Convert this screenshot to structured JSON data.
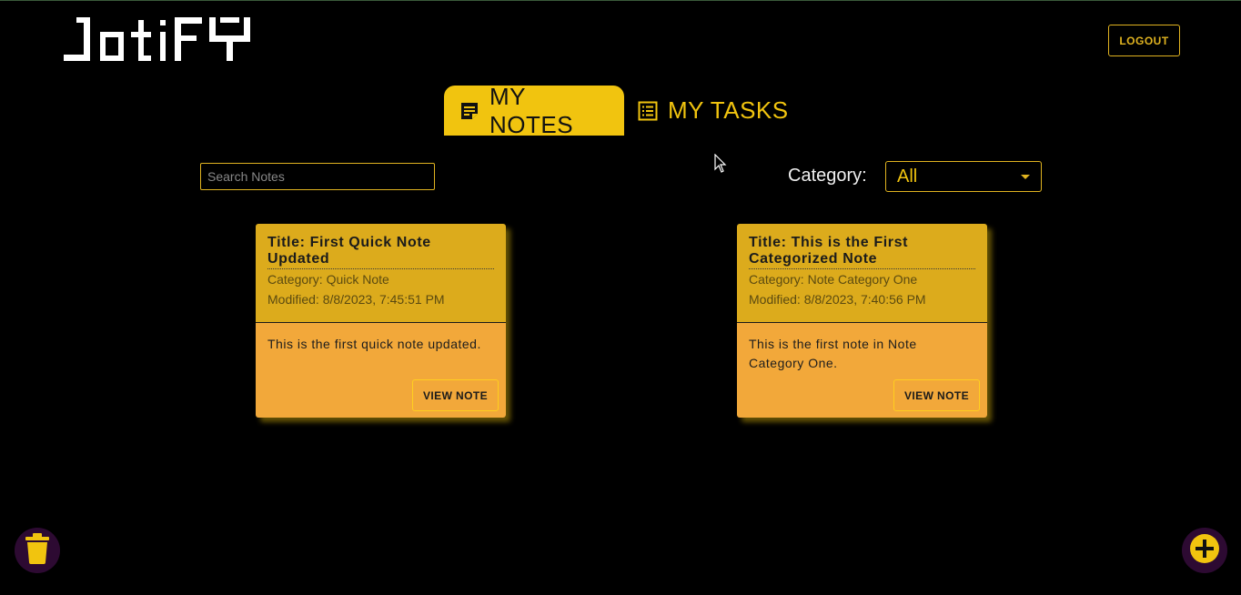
{
  "app": {
    "logo_text": "JotiFY"
  },
  "header": {
    "logout_label": "LOGOUT"
  },
  "tabs": [
    {
      "label": "MY NOTES",
      "icon": "sticky-note-icon",
      "active": true
    },
    {
      "label": "MY TASKS",
      "icon": "list-icon",
      "active": false
    }
  ],
  "search": {
    "placeholder": "Search Notes",
    "value": ""
  },
  "category": {
    "label": "Category:",
    "selected": "All"
  },
  "notes": [
    {
      "title": "Title: First Quick Note Updated",
      "category": "Category: Quick Note",
      "modified": "Modified: 8/8/2023, 7:45:51 PM",
      "body": "This is the first quick note updated.",
      "button_label": "VIEW NOTE"
    },
    {
      "title": "Title: This is the First Categorized Note",
      "category": "Category: Note Category One",
      "modified": "Modified: 8/8/2023, 7:40:56 PM",
      "body": "This is the first note in Note Category One.",
      "button_label": "VIEW NOTE"
    }
  ],
  "fabs": {
    "delete_icon": "trash-icon",
    "add_icon": "plus-circle-icon"
  },
  "colors": {
    "accent": "#f1c40f",
    "card_head": "#dcab1c",
    "card_body": "#f2a83a",
    "fab_bg": "#2d0a32"
  }
}
